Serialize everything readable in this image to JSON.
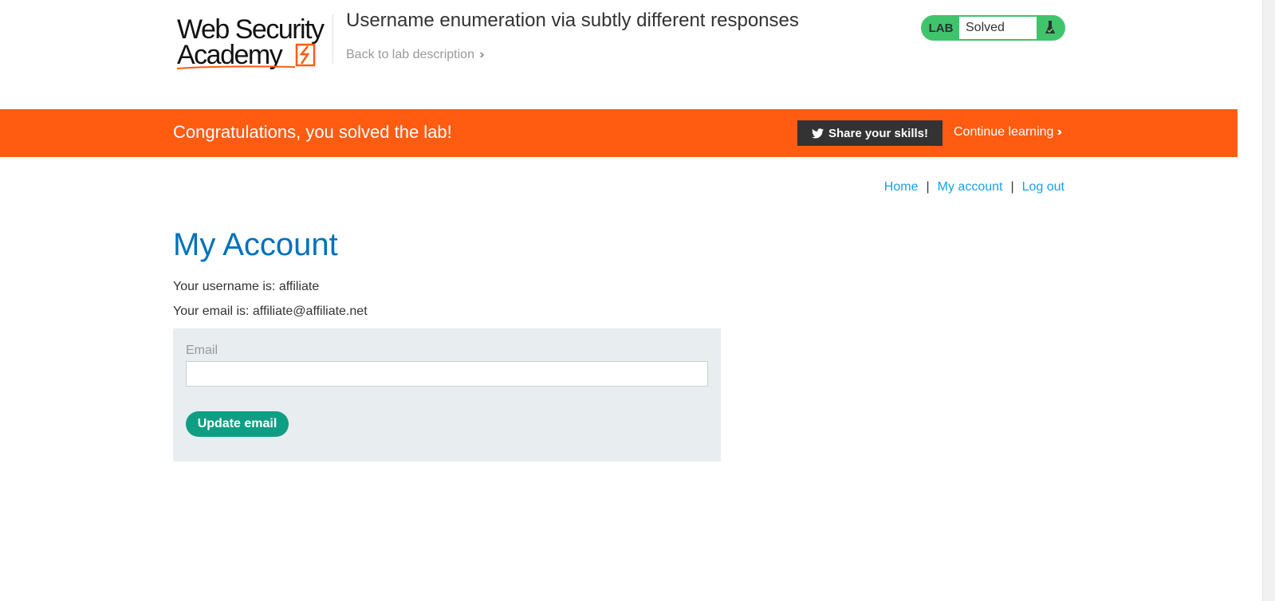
{
  "header": {
    "logo_alt": "Web Security Academy",
    "logo_line1": "Web Security",
    "logo_line2": "Academy",
    "lab_title": "Username enumeration via subtly different responses",
    "back_link": "Back to lab description"
  },
  "lab_status": {
    "tag": "LAB",
    "state": "Solved",
    "icon": "flask-icon"
  },
  "banner": {
    "message": "Congratulations, you solved the lab!",
    "share_label": "Share your skills!",
    "share_icon": "twitter-icon",
    "continue_label": "Continue learning",
    "color": "#ff5c12"
  },
  "nav": {
    "home": "Home",
    "separator": "|",
    "my_account": "My account",
    "log_out": "Log out"
  },
  "main": {
    "title": "My Account",
    "username_line": "Your username is: affiliate",
    "email_line": "Your email is: affiliate@affiliate.net"
  },
  "form": {
    "email_label": "Email",
    "email_value": "",
    "submit_label": "Update email"
  },
  "colors": {
    "accent_blue": "#0071bc",
    "link_blue": "#1aa0e8",
    "button_green": "#0e9e83",
    "status_green": "#3fc46b",
    "panel_bg": "#e8edf0"
  }
}
